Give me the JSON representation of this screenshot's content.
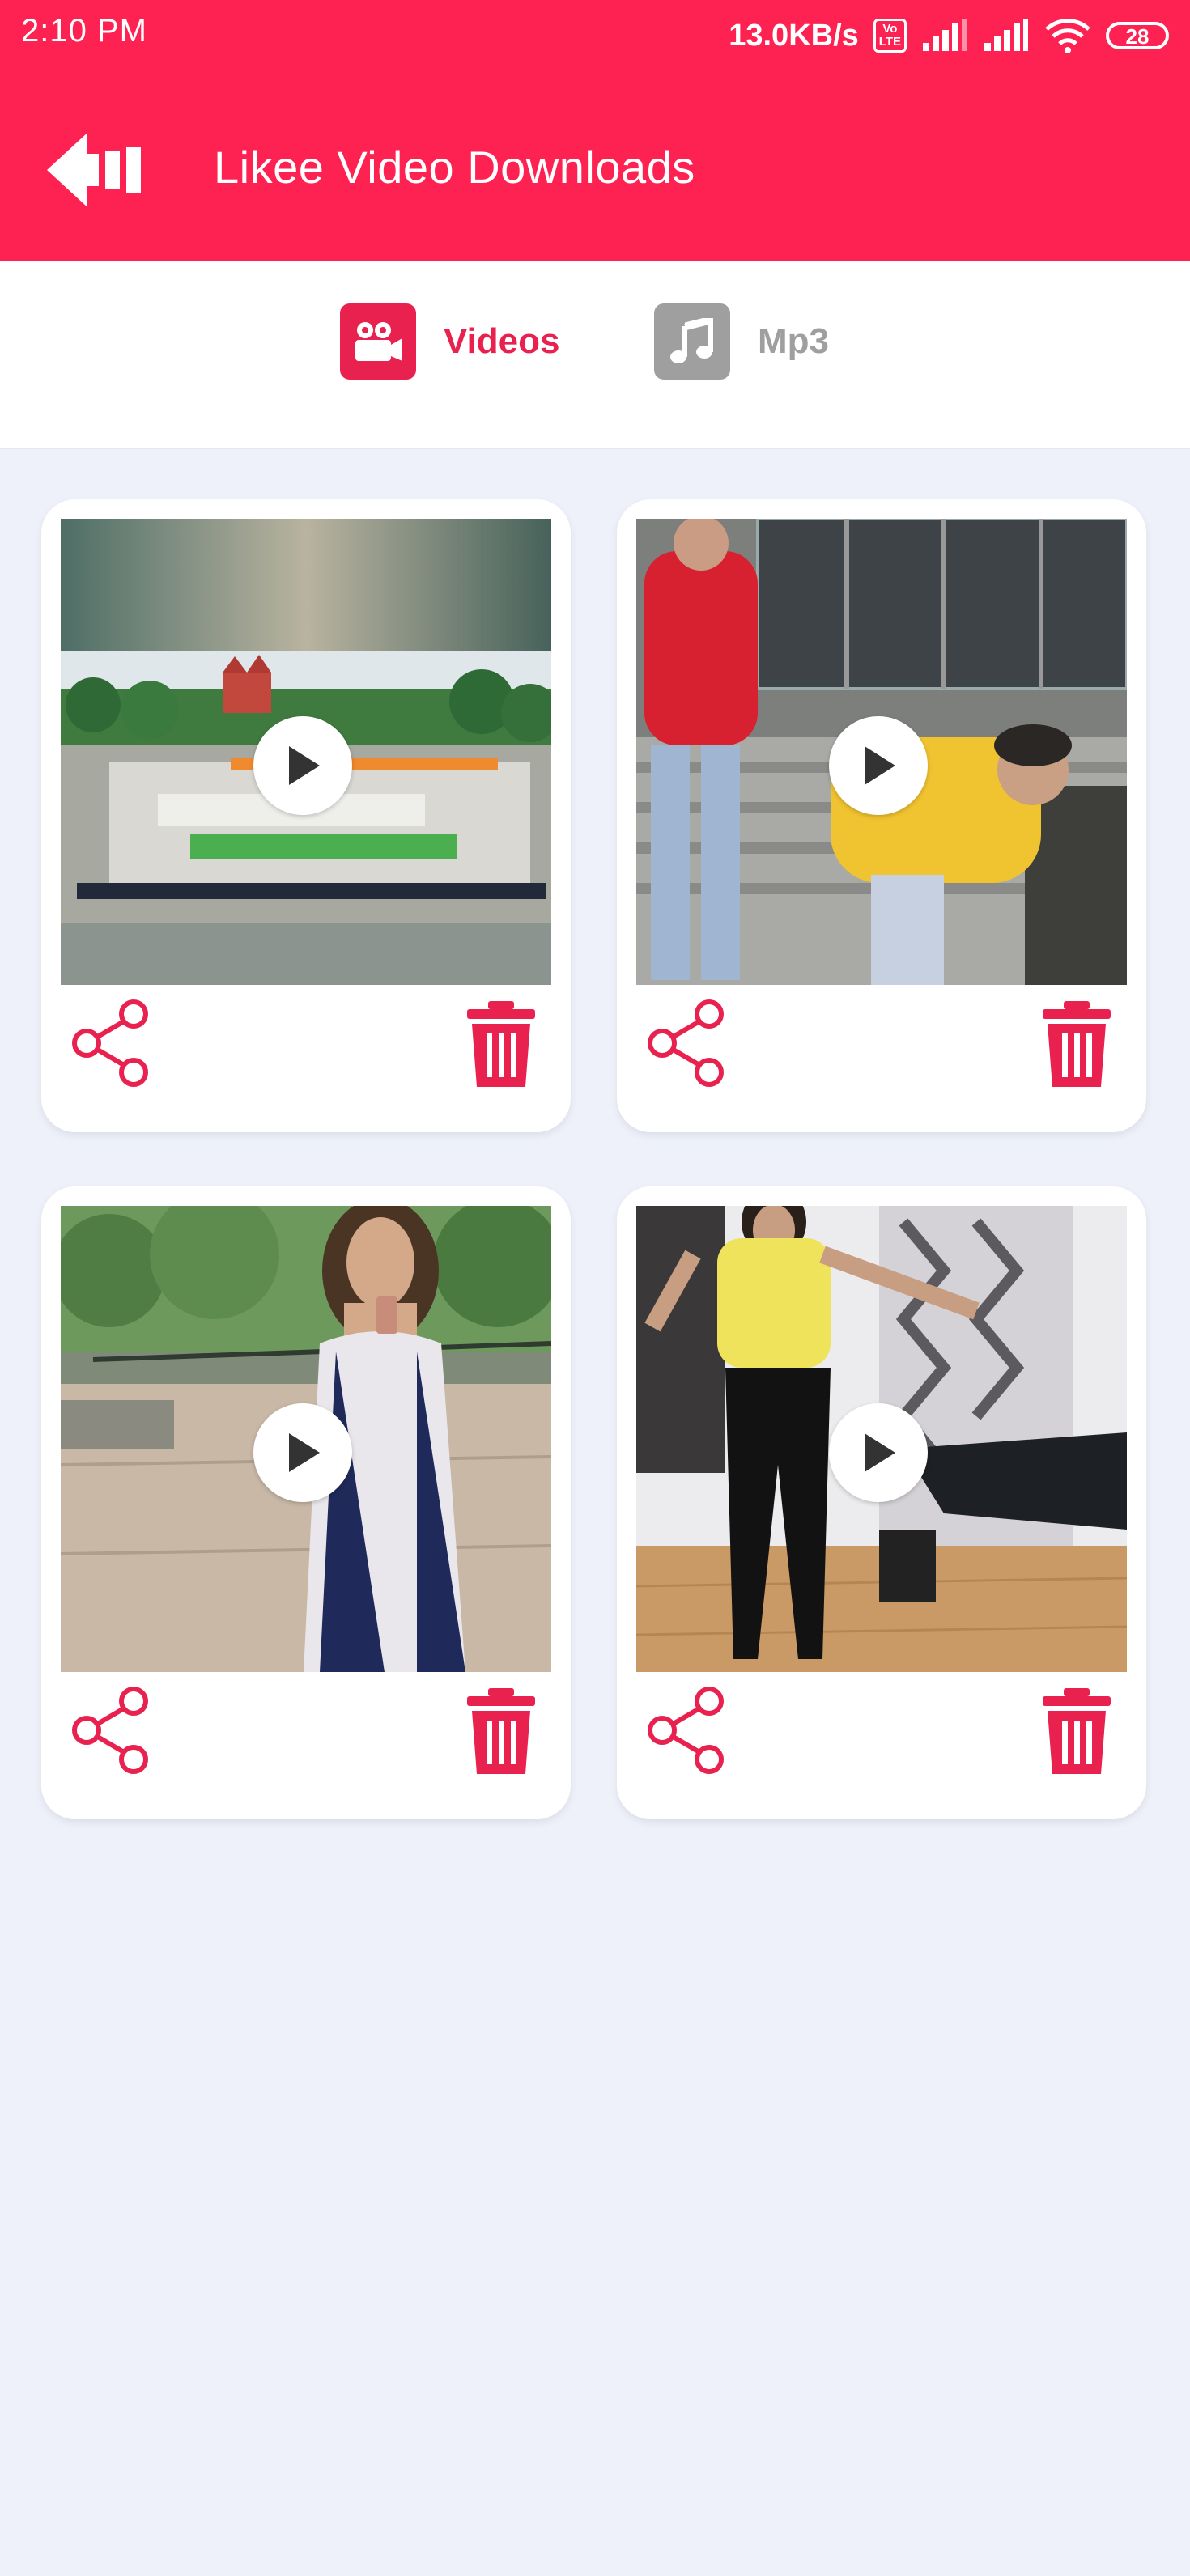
{
  "status_bar": {
    "time": "2:10 PM",
    "speed": "13.0KB/s",
    "volte_top": "Vo",
    "volte_bottom": "LTE",
    "battery": "28"
  },
  "header": {
    "title": "Likee Video Downloads",
    "back_icon": "back-arrow-icon"
  },
  "tabs": [
    {
      "label": "Videos",
      "icon": "video-camera-icon",
      "selected": true,
      "color": "#e8214f"
    },
    {
      "label": "Mp3",
      "icon": "music-note-icon",
      "selected": false,
      "color": "#9f9f9f"
    }
  ],
  "videos": [
    {
      "scene": "parade-ground-aerial",
      "actions": [
        "share-icon",
        "trash-icon"
      ]
    },
    {
      "scene": "two-people-on-steps",
      "actions": [
        "share-icon",
        "trash-icon"
      ]
    },
    {
      "scene": "woman-with-phone-in-park",
      "actions": [
        "share-icon",
        "trash-icon"
      ]
    },
    {
      "scene": "woman-dancing-in-gym",
      "actions": [
        "share-icon",
        "trash-icon"
      ]
    }
  ],
  "colors": {
    "accent": "#fd2251",
    "icon_red": "#e8214f",
    "background": "#eef1fa",
    "inactive": "#9f9f9f"
  }
}
